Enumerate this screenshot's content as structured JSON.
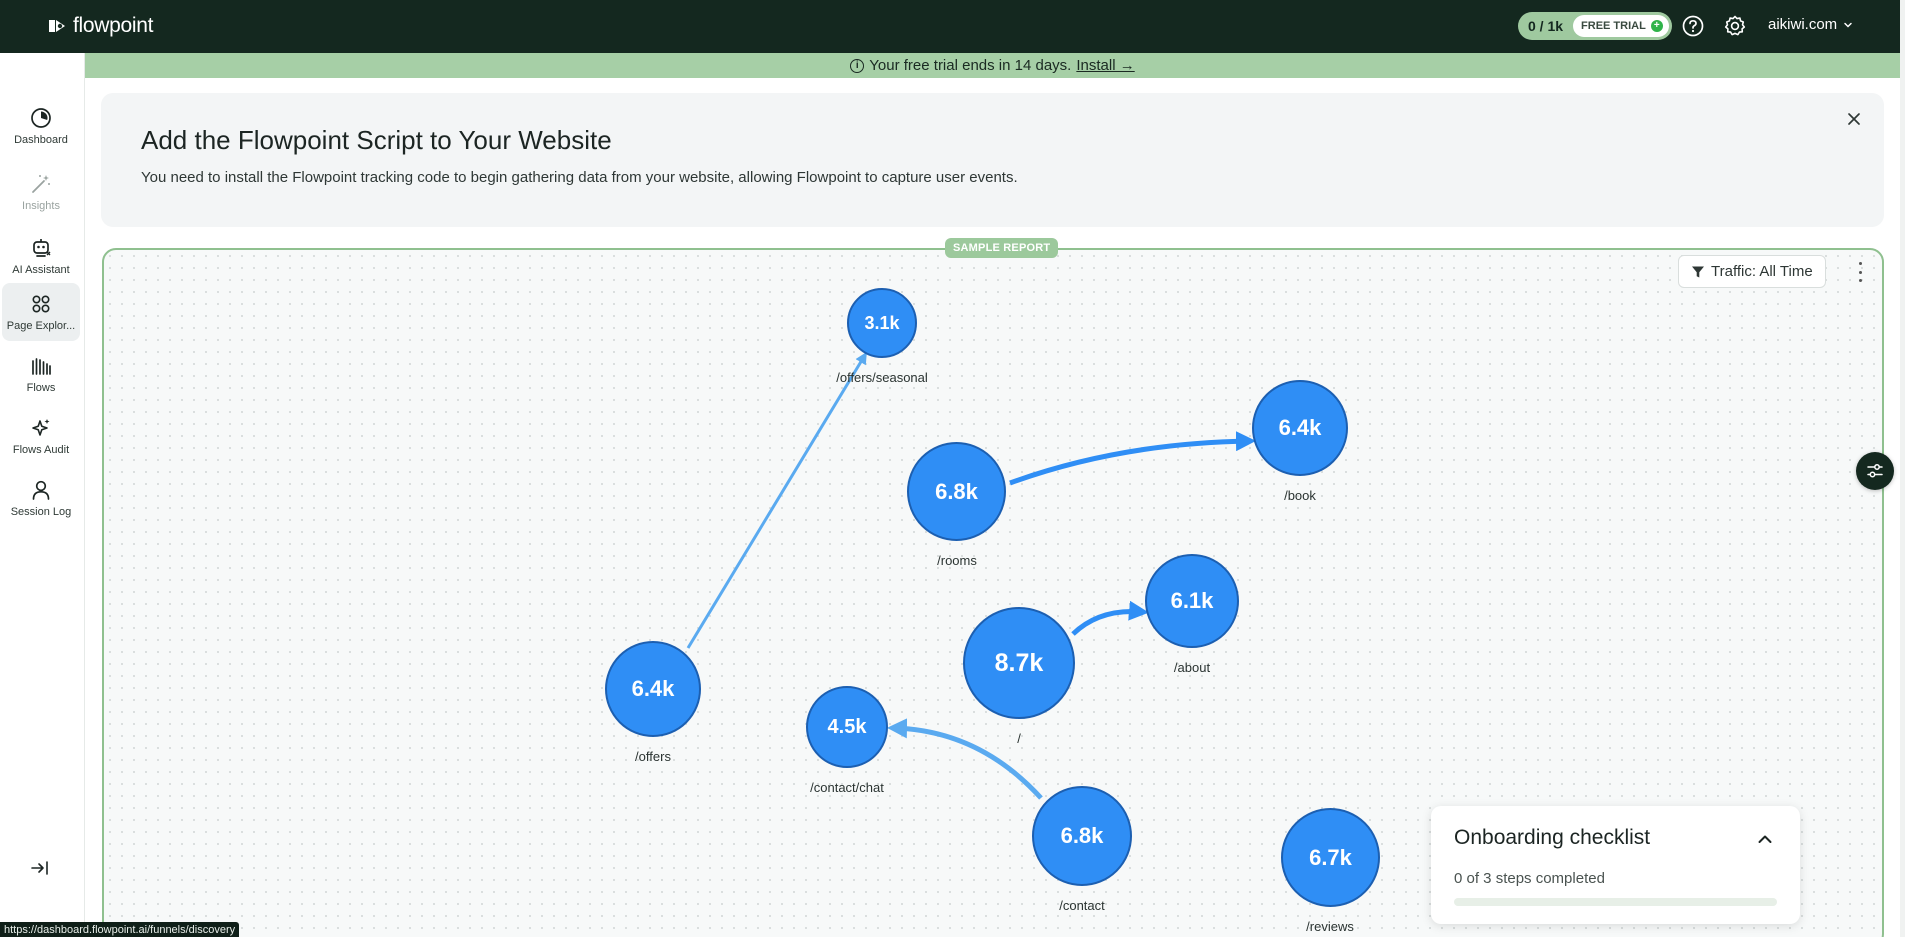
{
  "app": {
    "brand": "flowpoint",
    "quota": "0 / 1k",
    "trial_badge": "FREE TRIAL",
    "account": "aikiwi.com"
  },
  "sidebar": {
    "items": [
      {
        "label": "Dashboard",
        "icon": "dashboard-icon",
        "active": false,
        "muted": false
      },
      {
        "label": "Insights",
        "icon": "magic-wand-icon",
        "active": false,
        "muted": true
      },
      {
        "label": "AI Assistant",
        "icon": "robot-icon",
        "active": false,
        "muted": false
      },
      {
        "label": "Page Explor...",
        "icon": "grid-icon",
        "active": true,
        "muted": false
      },
      {
        "label": "Flows",
        "icon": "bars-icon",
        "active": false,
        "muted": false
      },
      {
        "label": "Flows Audit",
        "icon": "sparkle-icon",
        "active": false,
        "muted": false
      },
      {
        "label": "Session Log",
        "icon": "user-icon",
        "active": false,
        "muted": false
      }
    ]
  },
  "trial_banner": {
    "text": "Your free trial ends in 14 days.",
    "link": "Install →"
  },
  "install_card": {
    "title": "Add the Flowpoint Script to Your Website",
    "description": "You need to install the Flowpoint tracking code to begin gathering data from your website, allowing Flowpoint to capture user events."
  },
  "report": {
    "badge": "SAMPLE REPORT",
    "traffic_filter": "Traffic: All Time",
    "nodes": [
      {
        "id": "offers-seasonal",
        "value": "3.1k",
        "path": "/offers/seasonal"
      },
      {
        "id": "book",
        "value": "6.4k",
        "path": "/book"
      },
      {
        "id": "rooms",
        "value": "6.8k",
        "path": "/rooms"
      },
      {
        "id": "about",
        "value": "6.1k",
        "path": "/about"
      },
      {
        "id": "home",
        "value": "8.7k",
        "path": "/"
      },
      {
        "id": "offers",
        "value": "6.4k",
        "path": "/offers"
      },
      {
        "id": "contact-chat",
        "value": "4.5k",
        "path": "/contact/chat"
      },
      {
        "id": "contact",
        "value": "6.8k",
        "path": "/contact"
      },
      {
        "id": "reviews",
        "value": "6.7k",
        "path": "/reviews"
      }
    ],
    "links": [
      {
        "from": "/offers",
        "to": "/offers/seasonal"
      },
      {
        "from": "/rooms",
        "to": "/book"
      },
      {
        "from": "/",
        "to": "/about"
      },
      {
        "from": "/contact",
        "to": "/contact/chat"
      }
    ]
  },
  "checklist": {
    "title": "Onboarding checklist",
    "progress_text": "0 of 3 steps completed",
    "completed": 0,
    "total": 3
  },
  "status_bar": {
    "url": "https://dashboard.flowpoint.ai/funnels/discovery"
  },
  "colors": {
    "topbar": "#14281f",
    "accent_green": "#a6cfa6",
    "node_fill": "#2f8ef5",
    "node_border": "#1c5fb1",
    "link": "#5aaaf0"
  }
}
